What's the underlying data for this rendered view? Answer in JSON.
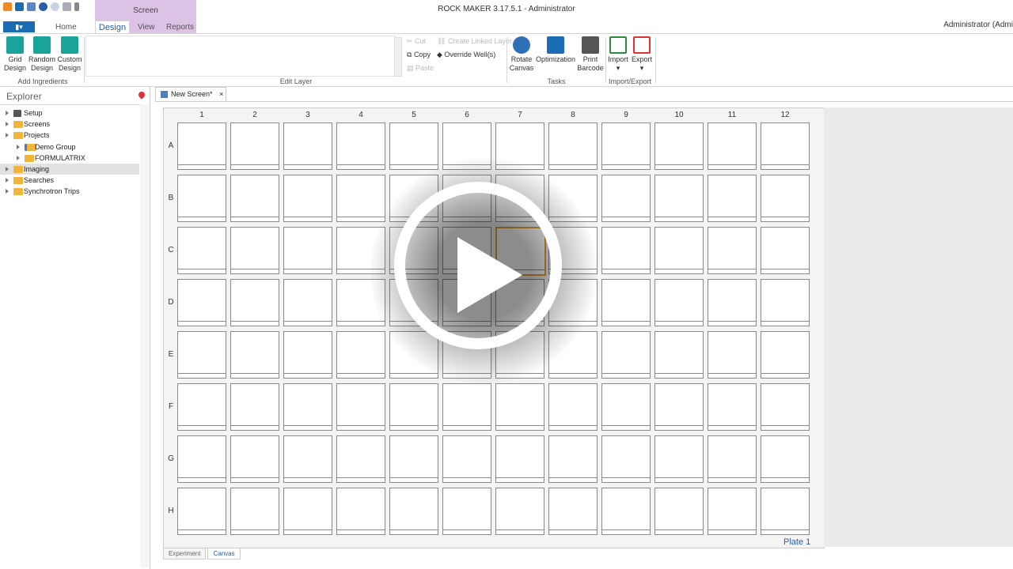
{
  "window": {
    "title": "ROCK MAKER 3.17.5.1 - Administrator",
    "user": "Administrator (Admi",
    "context_group": "Screen"
  },
  "ribbon_tabs": [
    "Home",
    "Design",
    "View",
    "Reports"
  ],
  "ribbon": {
    "add_ingredients": {
      "label": "Add Ingredients",
      "buttons": [
        {
          "line1": "Grid",
          "line2": "Design"
        },
        {
          "line1": "Random",
          "line2": "Design"
        },
        {
          "line1": "Custom",
          "line2": "Design"
        }
      ]
    },
    "edit_layer": {
      "label": "Edit Layer",
      "cut": "Cut",
      "copy": "Copy",
      "paste": "Paste",
      "create_linked_layer": "Create Linked Layer",
      "override_wells": "Override Well(s)"
    },
    "tasks": {
      "label": "Tasks",
      "buttons": [
        {
          "line1": "Rotate",
          "line2": "Canvas"
        },
        {
          "line1": "Optimization",
          "line2": ""
        },
        {
          "line1": "Print",
          "line2": "Barcode"
        }
      ]
    },
    "import_export": {
      "label": "Import/Export",
      "import": "Import",
      "export": "Export"
    }
  },
  "explorer": {
    "title": "Explorer",
    "items": [
      {
        "label": "Setup",
        "level": 0,
        "icon": "tools-icon"
      },
      {
        "label": "Screens",
        "level": 0,
        "icon": "folder-icon"
      },
      {
        "label": "Projects",
        "level": 0,
        "icon": "folder-icon"
      },
      {
        "label": "Demo Group",
        "level": 1,
        "icon": "group-folder-icon"
      },
      {
        "label": "FORMULATRIX",
        "level": 1,
        "icon": "folder-icon"
      },
      {
        "label": "Imaging",
        "level": 0,
        "icon": "folder-icon",
        "selected": true
      },
      {
        "label": "Searches",
        "level": 0,
        "icon": "folder-icon"
      },
      {
        "label": "Synchrotron Trips",
        "level": 0,
        "icon": "folder-icon"
      }
    ]
  },
  "document_tab": {
    "label": "New Screen*",
    "close": "×"
  },
  "plate": {
    "columns": [
      "1",
      "2",
      "3",
      "4",
      "5",
      "6",
      "7",
      "8",
      "9",
      "10",
      "11",
      "12"
    ],
    "rows": [
      "A",
      "B",
      "C",
      "D",
      "E",
      "F",
      "G",
      "H"
    ],
    "selected_well": "C7",
    "label": "Plate 1"
  },
  "bottom_tabs": {
    "experiment": "Experiment",
    "canvas": "Canvas",
    "active": "Canvas"
  },
  "colors": {
    "accent": "#1c6bb5",
    "context": "#dcc3e6",
    "selection": "#e0a030",
    "folder": "#f0b53a"
  }
}
